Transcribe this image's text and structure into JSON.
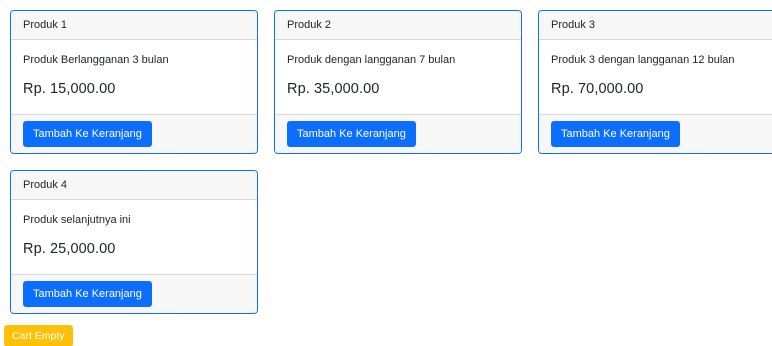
{
  "products": [
    {
      "header": "Produk 1",
      "description": "Produk Berlangganan 3 bulan",
      "price": "Rp. 15,000.00",
      "button_label": "Tambah Ke Keranjang"
    },
    {
      "header": "Produk 2",
      "description": "Produk dengan langganan 7 bulan",
      "price": "Rp. 35,000.00",
      "button_label": "Tambah Ke Keranjang"
    },
    {
      "header": "Produk 3",
      "description": "Produk 3 dengan langganan 12 bulan",
      "price": "Rp. 70,000.00",
      "button_label": "Tambah Ke Keranjang"
    },
    {
      "header": "Produk 4",
      "description": "Produk selanjutnya ini",
      "price": "Rp. 25,000.00",
      "button_label": "Tambah Ke Keranjang"
    }
  ],
  "cart": {
    "label": "Cart Empty"
  },
  "colors": {
    "primary": "#0d6efd",
    "warning": "#ffc107",
    "card_header_bg": "#f7f7f7"
  }
}
